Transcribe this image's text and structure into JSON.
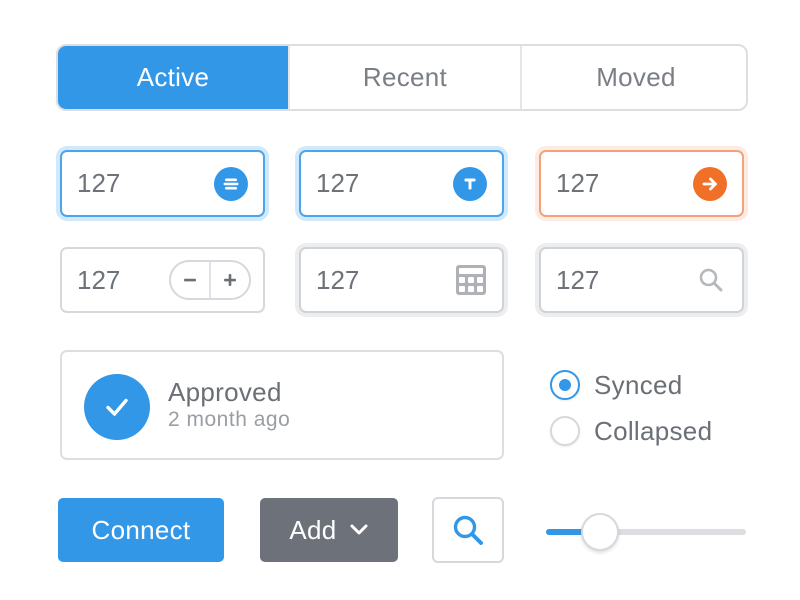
{
  "tabs": {
    "items": [
      {
        "label": "Active",
        "selected": true
      },
      {
        "label": "Recent",
        "selected": false
      },
      {
        "label": "Moved",
        "selected": false
      }
    ]
  },
  "inputs": {
    "row1": [
      {
        "value": "127",
        "icon": "strikethrough-icon",
        "accent": "#3397e8"
      },
      {
        "value": "127",
        "icon": "text-t-icon",
        "accent": "#3397e8"
      },
      {
        "value": "127",
        "icon": "arrow-right-icon",
        "accent": "#f07028"
      }
    ],
    "row2": [
      {
        "value": "127",
        "icon": "stepper"
      },
      {
        "value": "127",
        "icon": "calculator-icon"
      },
      {
        "value": "127",
        "icon": "search-icon"
      }
    ]
  },
  "card": {
    "title": "Approved",
    "subtitle": "2 month ago",
    "icon": "checkmark-icon"
  },
  "radios": [
    {
      "label": "Synced",
      "checked": true
    },
    {
      "label": "Collapsed",
      "checked": false
    }
  ],
  "buttons": {
    "connect": "Connect",
    "add": "Add",
    "search_icon": "search-icon"
  },
  "slider": {
    "value": 0.27
  },
  "colors": {
    "primary": "#3397e8",
    "orange": "#f07028",
    "dark_button": "#6c717a",
    "border": "#d5d8dc"
  }
}
